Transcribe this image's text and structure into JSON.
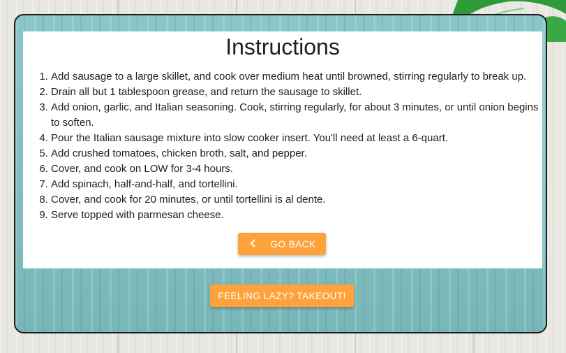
{
  "instructions": {
    "title": "Instructions",
    "steps": [
      "Add sausage to a large skillet, and cook over medium heat until browned, stirring regularly to break up.",
      "Drain all but 1 tablespoon grease, and return the sausage to skillet.",
      "Add onion, garlic, and Italian seasoning. Cook, stirring regularly, for about 3 minutes, or until onion begins to soften.",
      "Pour the Italian sausage mixture into slow cooker insert. You'll need at least a 6-quart.",
      "Add crushed tomatoes, chicken broth, salt, and pepper.",
      "Cover, and cook on LOW for 3-4 hours.",
      "Add spinach, half-and-half, and tortellini.",
      "Cover, and cook for 20 minutes, or until tortellini is al dente.",
      "Serve topped with parmesan cheese."
    ]
  },
  "buttons": {
    "go_back_label": "GO BACK",
    "go_back_icon": "chevron-left-icon",
    "takeout_label": "FEELING LAZY? TAKEOUT!"
  },
  "colors": {
    "accent": "#ffa23c",
    "card_background": "#7fc0c2",
    "card_border": "#1c1c1c",
    "panel_background": "#ffffff"
  }
}
